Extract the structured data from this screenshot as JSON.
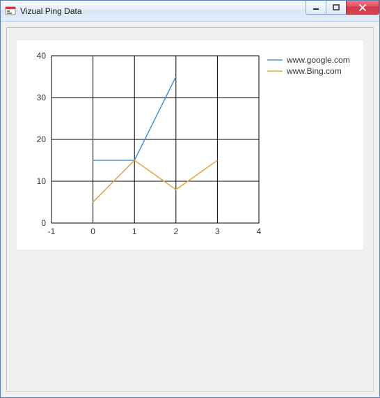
{
  "window": {
    "title": "Vizual Ping Data",
    "icon_name": "app-icon"
  },
  "titlebar_buttons": {
    "minimize": "Minimize",
    "maximize": "Maximize",
    "close": "Close"
  },
  "chart_data": {
    "type": "line",
    "title": "",
    "xlabel": "",
    "ylabel": "",
    "xlim": [
      -1,
      4
    ],
    "ylim": [
      0,
      40
    ],
    "x_ticks": [
      -1,
      0,
      1,
      2,
      3,
      4
    ],
    "y_ticks": [
      0,
      10,
      20,
      30,
      40
    ],
    "categories": [
      0,
      1,
      2,
      3
    ],
    "series": [
      {
        "name": "www.google.com",
        "color": "#4f93d1",
        "values": [
          15,
          15,
          35,
          null
        ]
      },
      {
        "name": "www.Bing.com",
        "color": "#e0a94e",
        "values": [
          5,
          15,
          8,
          15
        ]
      }
    ],
    "legend_position": "right"
  }
}
